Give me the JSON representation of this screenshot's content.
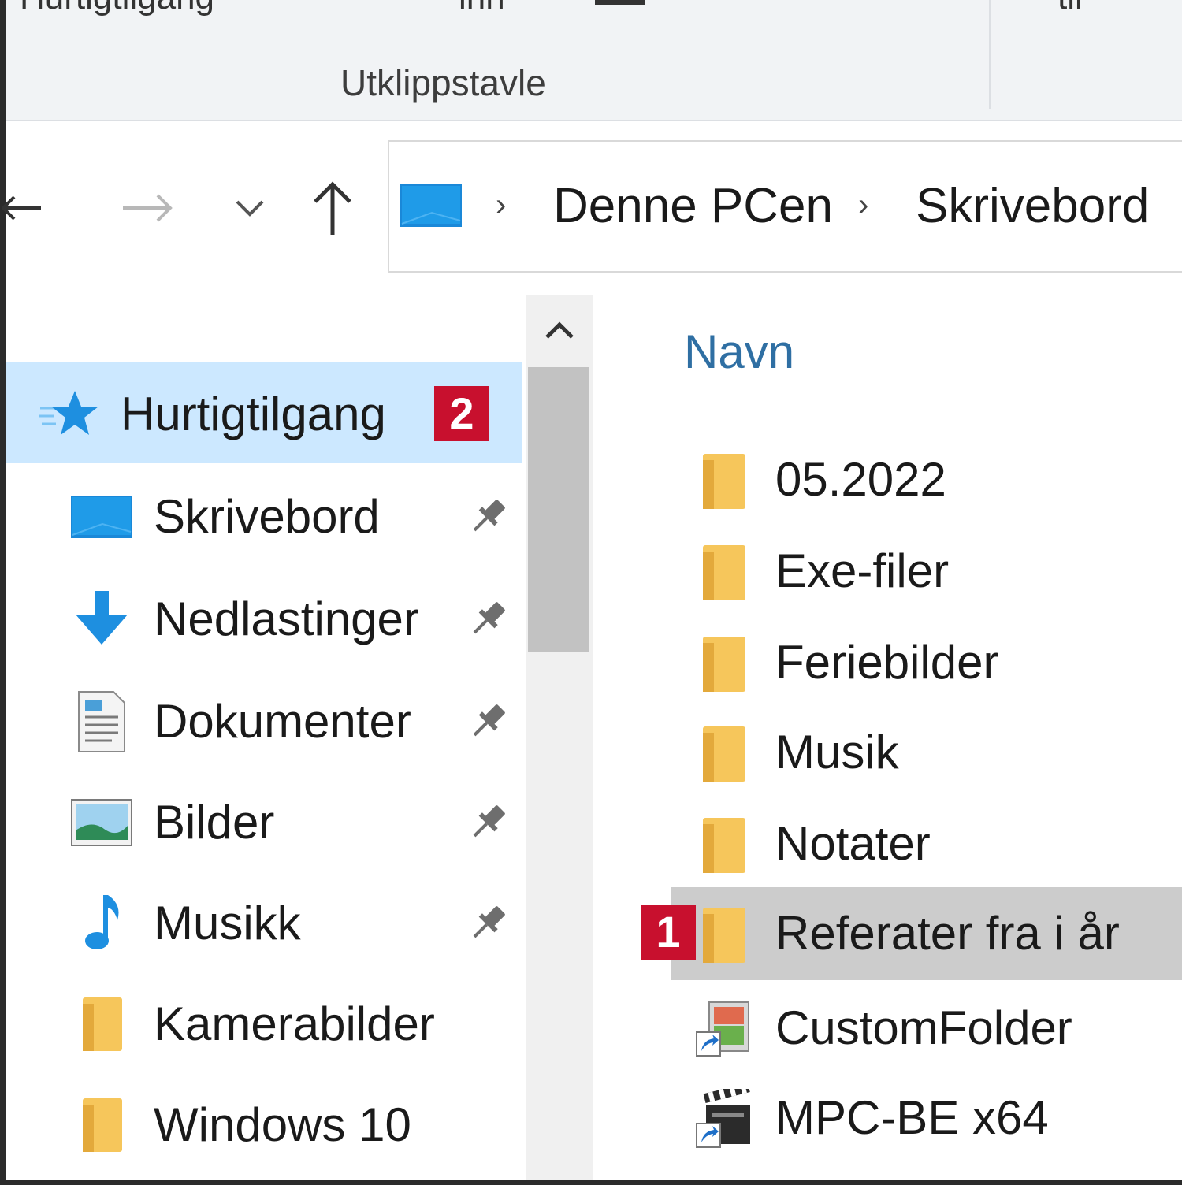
{
  "ribbon": {
    "cut_labels": [
      "Hurtigtilgang",
      "inn",
      "til"
    ],
    "group_label": "Utklippstavle"
  },
  "nav": {
    "breadcrumb": [
      "Denne PCen",
      "Skrivebord"
    ]
  },
  "sidebar": {
    "items": [
      {
        "label": "Hurtigtilgang",
        "icon": "star-icon",
        "selected": true,
        "badge": "2"
      },
      {
        "label": "Skrivebord",
        "icon": "desktop-icon",
        "pinned": true
      },
      {
        "label": "Nedlastinger",
        "icon": "download-icon",
        "pinned": true
      },
      {
        "label": "Dokumenter",
        "icon": "document-icon",
        "pinned": true
      },
      {
        "label": "Bilder",
        "icon": "pictures-icon",
        "pinned": true
      },
      {
        "label": "Musikk",
        "icon": "music-icon",
        "pinned": true
      },
      {
        "label": "Kamerabilder",
        "icon": "folder-icon"
      },
      {
        "label": "Windows 10",
        "icon": "folder-icon"
      }
    ]
  },
  "filelist": {
    "column_header": "Navn",
    "items": [
      {
        "label": "05.2022",
        "icon": "folder-icon"
      },
      {
        "label": "Exe-filer",
        "icon": "folder-icon"
      },
      {
        "label": "Feriebilder",
        "icon": "folder-icon"
      },
      {
        "label": "Musik",
        "icon": "folder-icon"
      },
      {
        "label": "Notater",
        "icon": "folder-icon"
      },
      {
        "label": "Referater fra i år",
        "icon": "folder-icon",
        "selected": true,
        "badge": "1"
      },
      {
        "label": "CustomFolder",
        "icon": "shortcut-icon"
      },
      {
        "label": "MPC-BE x64",
        "icon": "video-shortcut-icon"
      }
    ]
  },
  "colors": {
    "selection_sidebar": "#cce8ff",
    "selection_file": "#cccccc",
    "badge": "#c8102e",
    "header_text": "#2f6fa3",
    "folder": "#f6c65b"
  }
}
